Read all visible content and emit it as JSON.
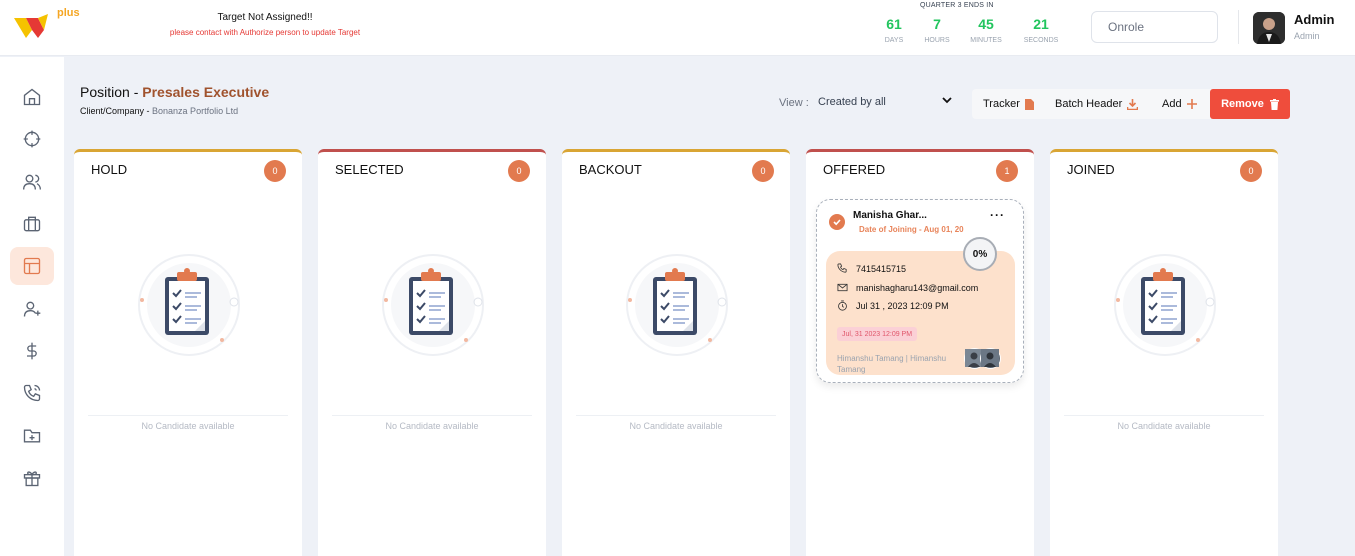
{
  "brand": {
    "logo_text": "plus",
    "logo_color": "#f5a623",
    "logo_accent": "#e53935"
  },
  "target": {
    "title": "Target Not Assigned!!",
    "subtitle": "please contact with Authorize person to update Target"
  },
  "quarter": {
    "label": "QUARTER 3 ENDS IN",
    "days": {
      "value": "61",
      "unit": "DAYS"
    },
    "hours": {
      "value": "7",
      "unit": "HOURS"
    },
    "minutes": {
      "value": "45",
      "unit": "MINUTES"
    },
    "seconds": {
      "value": "21",
      "unit": "SECONDS"
    }
  },
  "role_selector": {
    "value": "Onrole"
  },
  "user": {
    "name": "Admin",
    "role": "Admin"
  },
  "sidebar": {
    "items": [
      {
        "icon": "home-icon",
        "active": false
      },
      {
        "icon": "target-icon",
        "active": false
      },
      {
        "icon": "users-icon",
        "active": false
      },
      {
        "icon": "briefcase-icon",
        "active": false
      },
      {
        "icon": "layout-icon",
        "active": true
      },
      {
        "icon": "user-plus-icon",
        "active": false
      },
      {
        "icon": "dollar-icon",
        "active": false
      },
      {
        "icon": "phone-call-icon",
        "active": false
      },
      {
        "icon": "folder-plus-icon",
        "active": false
      },
      {
        "icon": "gift-icon",
        "active": false
      }
    ]
  },
  "page": {
    "position_label": "Position - ",
    "position_name": "Presales Executive",
    "client_label": "Client/Company - ",
    "client_name": "Bonanza Portfolio Ltd"
  },
  "view": {
    "label": "View :",
    "selected": "Created by all"
  },
  "toolbar": {
    "tracker": "Tracker",
    "batch_header": "Batch Header",
    "add": "Add",
    "remove": "Remove"
  },
  "columns": [
    {
      "title": "HOLD",
      "count": "0",
      "empty_text": "No Candidate available"
    },
    {
      "title": "SELECTED",
      "count": "0",
      "empty_text": "No Candidate available"
    },
    {
      "title": "BACKOUT",
      "count": "0",
      "empty_text": "No Candidate available"
    },
    {
      "title": "OFFERED",
      "count": "1",
      "empty_text": ""
    },
    {
      "title": "JOINED",
      "count": "0",
      "empty_text": "No Candidate available"
    }
  ],
  "candidate": {
    "name": "Manisha Ghar...",
    "doj": "Date of Joining - Aug 01, 20",
    "progress": "0%",
    "progress_value": 0,
    "phone": "7415415715",
    "email": "manishagharu143@gmail.com",
    "datetime": "Jul 31 , 2023 12:09 PM",
    "date_chip": "Jul, 31 2023 12:09 PM",
    "recruiters": "Himanshu Tamang | Himanshu Tamang"
  },
  "colors": {
    "accent": "#e27a4f",
    "remove": "#ef4d3c",
    "countdown": "#22c55e",
    "column_yellow": "#d9a534",
    "column_red": "#c0504d"
  }
}
